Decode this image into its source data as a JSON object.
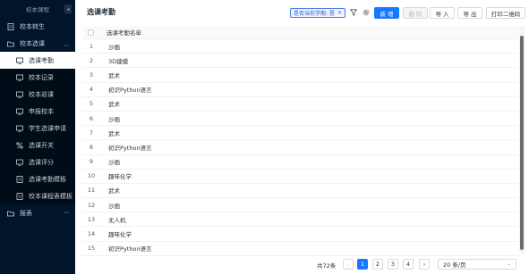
{
  "sidebar": {
    "header": "校本课程",
    "collapse_glyph": "◂",
    "top_items": [
      {
        "label": "校本转生",
        "icon": "document-icon"
      },
      {
        "label": "校本选课",
        "icon": "folder-icon",
        "arrow": "︿"
      }
    ],
    "sub_items": [
      {
        "label": "选课考勤",
        "icon": "monitor-icon",
        "active": true
      },
      {
        "label": "校本记录",
        "icon": "monitor-icon"
      },
      {
        "label": "校本巡课",
        "icon": "monitor-icon"
      },
      {
        "label": "申报校本",
        "icon": "monitor-icon"
      },
      {
        "label": "学生选课申请",
        "icon": "monitor-icon"
      },
      {
        "label": "选课开关",
        "icon": "percent-icon"
      },
      {
        "label": "选课评分",
        "icon": "monitor-icon"
      },
      {
        "label": "选课考勤模板",
        "icon": "document-icon"
      },
      {
        "label": "校本课程表模板",
        "icon": "document-icon"
      }
    ],
    "bottom_items": [
      {
        "label": "报表",
        "icon": "folder-icon",
        "arrow": "﹀"
      }
    ]
  },
  "toolbar": {
    "title": "选课考勤",
    "filter_tag": "是否当前学期: 是",
    "filter_tag_close": "×",
    "new_label": "新 增",
    "delete_label": "删 除",
    "import_label": "导 入",
    "export_label": "导 出",
    "print_label": "打印二维码"
  },
  "table": {
    "header": "选课考勤名单",
    "rows": [
      {
        "index": "1",
        "name": "沙画"
      },
      {
        "index": "2",
        "name": "3D建模"
      },
      {
        "index": "3",
        "name": "武术"
      },
      {
        "index": "4",
        "name": "初识Python语言"
      },
      {
        "index": "5",
        "name": "武术"
      },
      {
        "index": "6",
        "name": "沙画"
      },
      {
        "index": "7",
        "name": "武术"
      },
      {
        "index": "8",
        "name": "初识Python语言"
      },
      {
        "index": "9",
        "name": "沙画"
      },
      {
        "index": "10",
        "name": "趣味化学"
      },
      {
        "index": "11",
        "name": "武术"
      },
      {
        "index": "12",
        "name": "沙画"
      },
      {
        "index": "13",
        "name": "无人机"
      },
      {
        "index": "14",
        "name": "趣味化学"
      },
      {
        "index": "15",
        "name": "初识Python语言"
      }
    ]
  },
  "pagination": {
    "total": "共72条",
    "prev": "‹",
    "pages": [
      "1",
      "2",
      "3",
      "4"
    ],
    "next": "›",
    "page_size": "20 条/页",
    "chev": "⌄"
  }
}
